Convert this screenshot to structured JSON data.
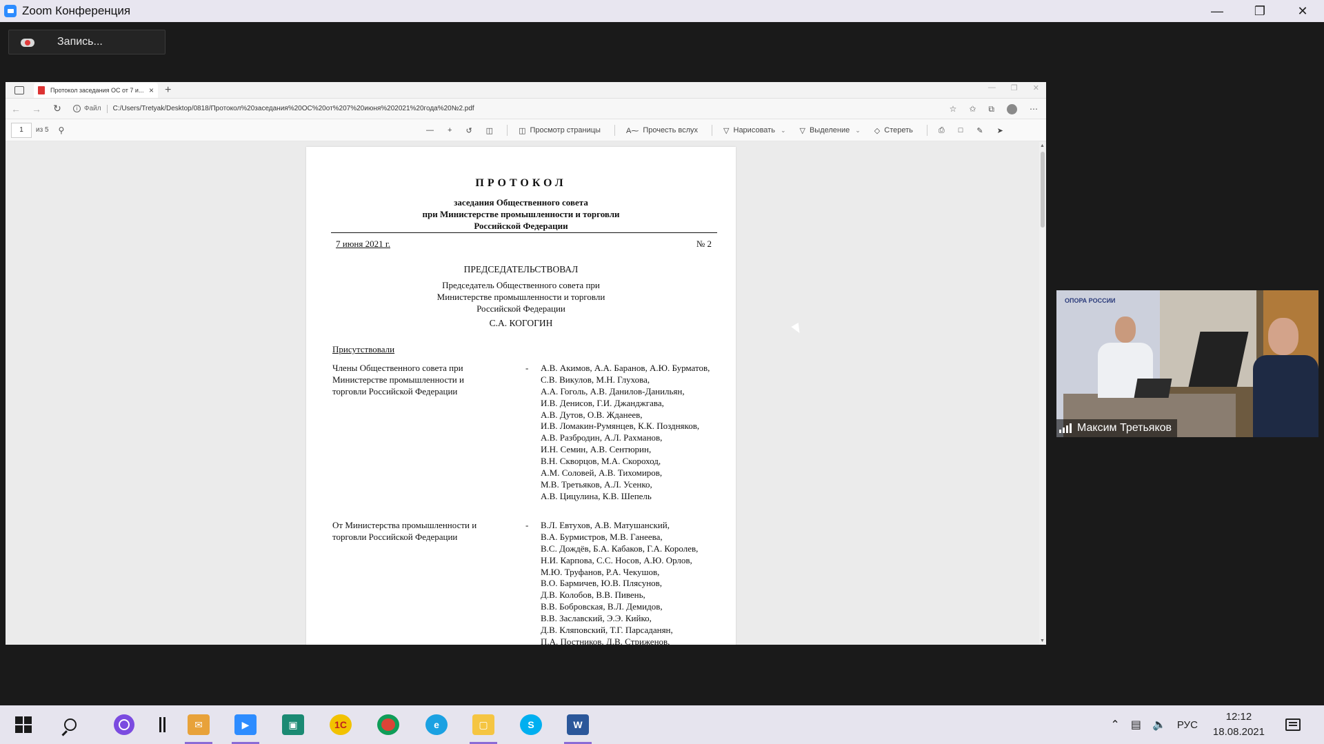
{
  "zoom": {
    "title": "Zoom Конференция",
    "record_label": "Запись..."
  },
  "browser": {
    "tab_title": "Протокол заседания ОС от 7 и...",
    "url_scheme": "Файл",
    "url": "C:/Users/Tretyak/Desktop/0818/Протокол%20заседания%20ОС%20от%207%20июня%202021%20года%20№2.pdf"
  },
  "pdf_toolbar": {
    "page_current": "1",
    "page_total": "из 5",
    "tools": [
      "Просмотр страницы",
      "Прочесть вслух",
      "Нарисовать",
      "Выделение",
      "Стереть"
    ]
  },
  "document": {
    "title": "ПРОТОКОЛ",
    "subtitle_lines": [
      "заседания Общественного совета",
      "при Министерстве промышленности и торговли",
      "Российской Федерации"
    ],
    "date": "7 июня 2021 г.",
    "number": "№ 2",
    "chair_heading": "ПРЕДСЕДАТЕЛЬСТВОВАЛ",
    "chair_position_lines": [
      "Председатель Общественного совета при",
      "Министерстве промышленности и торговли",
      "Российской Федерации"
    ],
    "chair_name": "С.А. КОГОГИН",
    "present_heading": "Присутствовали",
    "groups": [
      {
        "label": "Члены Общественного совета при Министерстве промышленности и торговли Российской Федерации",
        "dash": "-",
        "names": [
          "А.В. Акимов, А.А. Баранов, А.Ю. Бурматов,",
          "С.В. Викулов, М.Н. Глухова,",
          "А.А. Гоголь, А.В. Данилов-Данильян,",
          "И.В. Денисов, Г.И. Джанджгава,",
          "А.В. Дутов, О.В. Жданеев,",
          "И.В. Ломакин-Румянцев, К.К. Поздняков,",
          "А.В. Разбродин, А.Л. Рахманов,",
          "И.Н. Семин, А.В. Сентюрин,",
          "В.Н. Скворцов, М.А. Скороход,",
          "А.М. Соловей, А.В. Тихомиров,",
          "М.В. Третьяков, А.Л. Усенко,",
          "А.В. Цицулина, К.В. Шепель"
        ]
      },
      {
        "label": "От Министерства промышленности и торговли Российской Федерации",
        "dash": "-",
        "names": [
          "В.Л. Евтухов, А.В. Матушанский,",
          "В.А. Бурмистров, М.В. Ганеева,",
          "В.С. Дождёв, Б.А. Кабаков, Г.А. Королев,",
          "Н.И. Карпова, С.С. Носов, А.Ю. Орлов,",
          "М.Ю. Труфанов, Р.А. Чекушов,",
          "В.О. Бармичев, Ю.В. Плясунов,",
          "Д.В. Колобов, В.В. Пивень,",
          "В.В. Бобровская, В.Л. Демидов,",
          "В.В. Заславский, Э.Э. Кийко,",
          "Д.В. Кляповский, Т.Г. Парсаданян,",
          "П.А. Постников, Д.В. Стриженов,"
        ]
      }
    ]
  },
  "video": {
    "participant_name": "Максим Третьяков",
    "banner_text": "ОПОРА РОССИИ"
  },
  "taskbar": {
    "lang": "РУС",
    "time": "12:12",
    "date": "18.08.2021"
  }
}
